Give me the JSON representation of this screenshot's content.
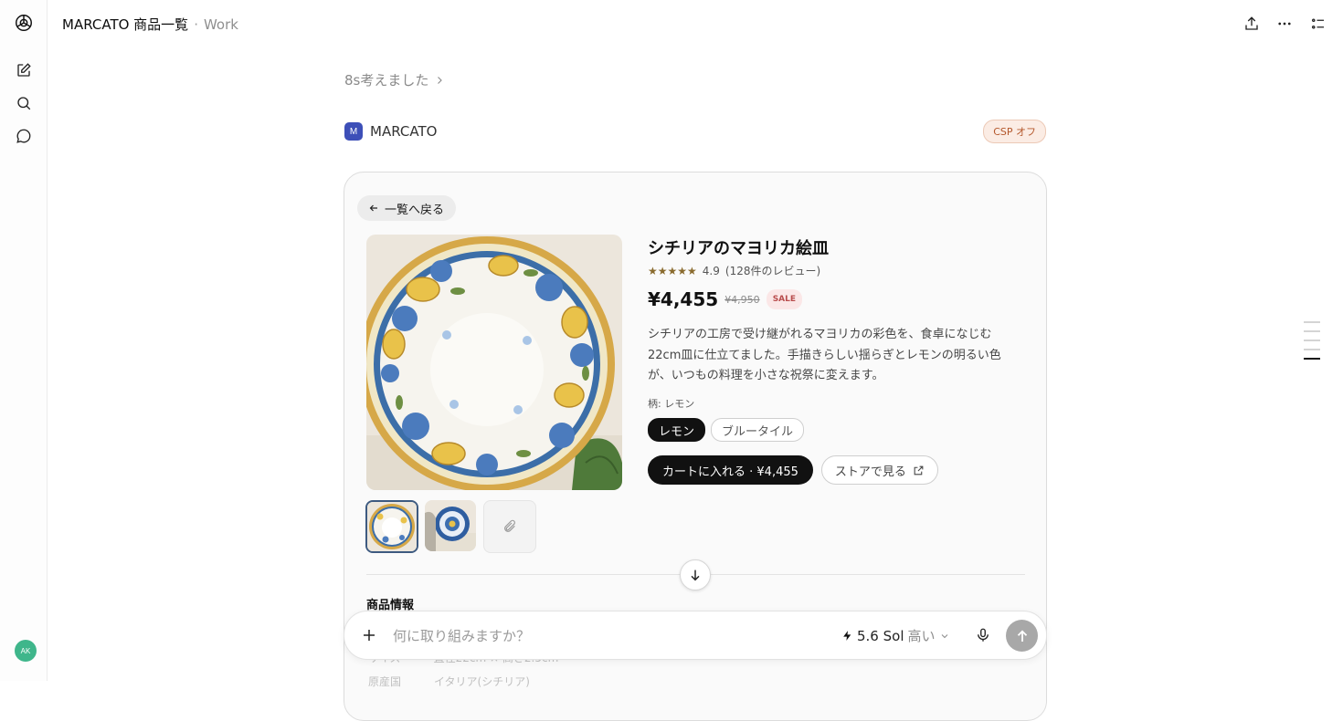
{
  "app": {
    "title": "MARCATO 商品一覧",
    "workspace": "Work"
  },
  "user": {
    "initials": "AK"
  },
  "thought": {
    "label": "8s考えました"
  },
  "widget": {
    "name": "MARCATO",
    "badge_letter": "M",
    "csp_label": "CSP オフ"
  },
  "product": {
    "back_label": "一覧へ戻る",
    "title": "シチリアのマヨリカ絵皿",
    "stars": "★★★★★",
    "rating": "4.9",
    "reviews": "(128件のレビュー)",
    "price": "¥4,455",
    "old_price": "¥4,950",
    "sale_badge": "SALE",
    "description": "シチリアの工房で受け継がれるマヨリカの彩色を、食卓になじむ22cm皿に仕立てました。手描きらしい揺らぎとレモンの明るい色が、いつもの料理を小さな祝祭に変えます。",
    "variant_label": "柄: レモン",
    "variants": [
      "レモン",
      "ブルータイル"
    ],
    "cart_label": "カートに入れる · ¥4,455",
    "store_label": "ストアで見る",
    "info_title": "商品情報",
    "info_rows": [
      "サイズ　　　直径22cm × 高さ2.5cm",
      "原産国　　　イタリア(シチリア)"
    ]
  },
  "composer": {
    "placeholder": "何に取り組みますか？",
    "model": "5.6 Sol",
    "level": "高い"
  },
  "colors": {
    "accent": "#111111",
    "sale": "#b94d4d",
    "csp": "#b4572b",
    "badge": "#3d4fb8"
  }
}
